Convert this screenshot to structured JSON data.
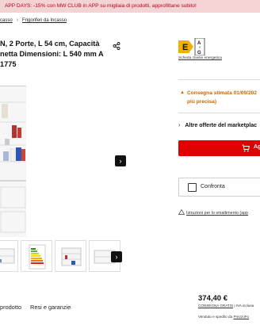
{
  "promo": {
    "text": "APP DAYS: -15% con MW CLUB in APP su migliaia di prodotti, approfittane subito!"
  },
  "breadcrumb": {
    "prev": "casso",
    "current": "Frigoriferi da Incasso"
  },
  "product": {
    "title": "N, 2 Porte, L 54 cm, Capacità netta Dimensioni: L 540 mm A 1775",
    "energy_class": "E",
    "energy_scale_top": "A",
    "energy_scale_bottom": "G",
    "energy_link": "Scheda classe energetica"
  },
  "delivery": {
    "line1": "Consegna stimata 01/09/202",
    "line2": "più precisa)"
  },
  "offers": {
    "chevron": "›",
    "label": "Altre offerte del marketplac"
  },
  "cart": {
    "label": "Ag",
    "color": "#df0000"
  },
  "compare": {
    "label": "Confronta"
  },
  "disposal": {
    "label": "Istruzioni per lo smaltimento (app"
  },
  "buy": {
    "price": "374,40 €",
    "shipping_link": "CONSEGNA GRATIS",
    "shipping_rest": " | IVA inclusa",
    "sold_prefix": "Venduto e spedito da ",
    "sold_by": "PrezzoFo"
  },
  "tabs": {
    "product": "prodotto",
    "returns": "Resi e garanzie"
  },
  "nav": {
    "next": "›"
  }
}
